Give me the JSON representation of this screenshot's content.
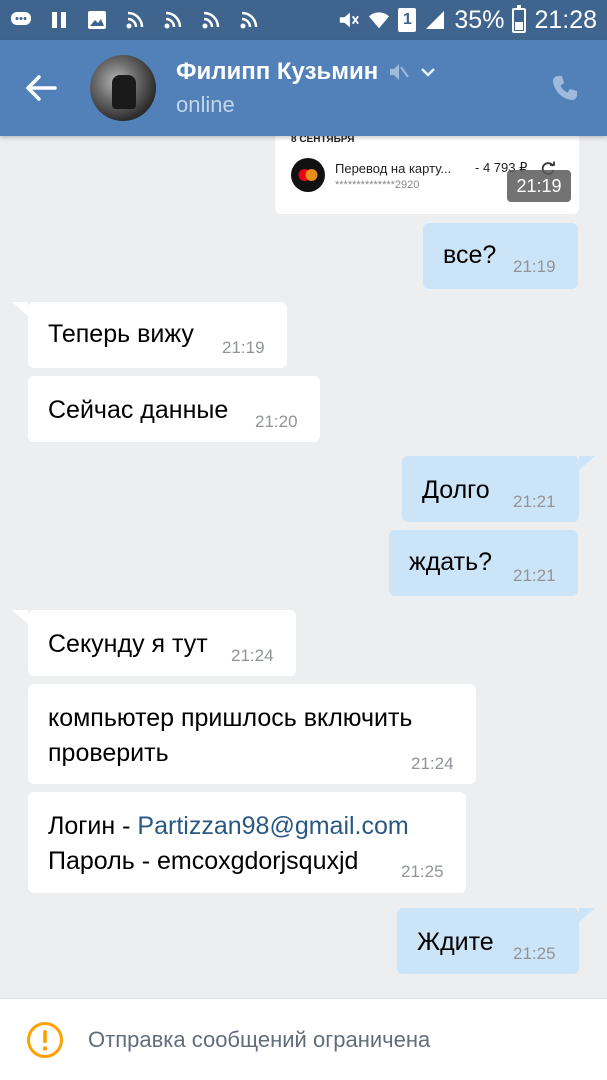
{
  "status_bar": {
    "icons": [
      "vk-message-icon",
      "pause-icon",
      "image-icon",
      "rss-icon",
      "rss-icon",
      "rss-icon",
      "rss-icon",
      "mute-icon",
      "wifi-icon",
      "sim-icon",
      "signal-icon"
    ],
    "sim_label": "1",
    "battery": "35%",
    "battery_level": 0.35,
    "time": "21:28"
  },
  "header": {
    "contact_name": "Филипп Кузьмин",
    "status": "online"
  },
  "attachment": {
    "date": "8 СЕНТЯБРЯ",
    "title": "Перевод на карту...",
    "card_masked": "**************2920",
    "amount": "- 4 793 ₽",
    "time": "21:19"
  },
  "messages": [
    {
      "dir": "out",
      "text": "все?",
      "time": "21:19"
    },
    {
      "dir": "in",
      "text": "Теперь вижу",
      "time": "21:19"
    },
    {
      "dir": "in",
      "text": "Сейчас данные",
      "time": "21:20"
    },
    {
      "dir": "out",
      "text": "Долго",
      "time": "21:21"
    },
    {
      "dir": "out",
      "text": "ждать?",
      "time": "21:21"
    },
    {
      "dir": "in",
      "text": "Секунду я тут",
      "time": "21:24"
    },
    {
      "dir": "in",
      "text_line1": "компьютер пришлось включить",
      "text_line2": "проверить",
      "time": "21:24"
    },
    {
      "dir": "in",
      "login_prefix": "Логин - ",
      "login_value": "Partizzan98@gmail.com",
      "password_line": "Пароль - emcoxgdorjsquxjd",
      "time": "21:25"
    },
    {
      "dir": "out",
      "text": "Ждите",
      "time": "21:25"
    }
  ],
  "bottom_bar": {
    "text": "Отправка сообщений ограничена"
  },
  "colors": {
    "status_bar": "#3f658f",
    "header": "#5181b8",
    "background": "#edeef0",
    "incoming_bubble": "#ffffff",
    "outgoing_bubble": "#cce4f7",
    "link": "#2a5885",
    "warning": "#ffa000"
  }
}
